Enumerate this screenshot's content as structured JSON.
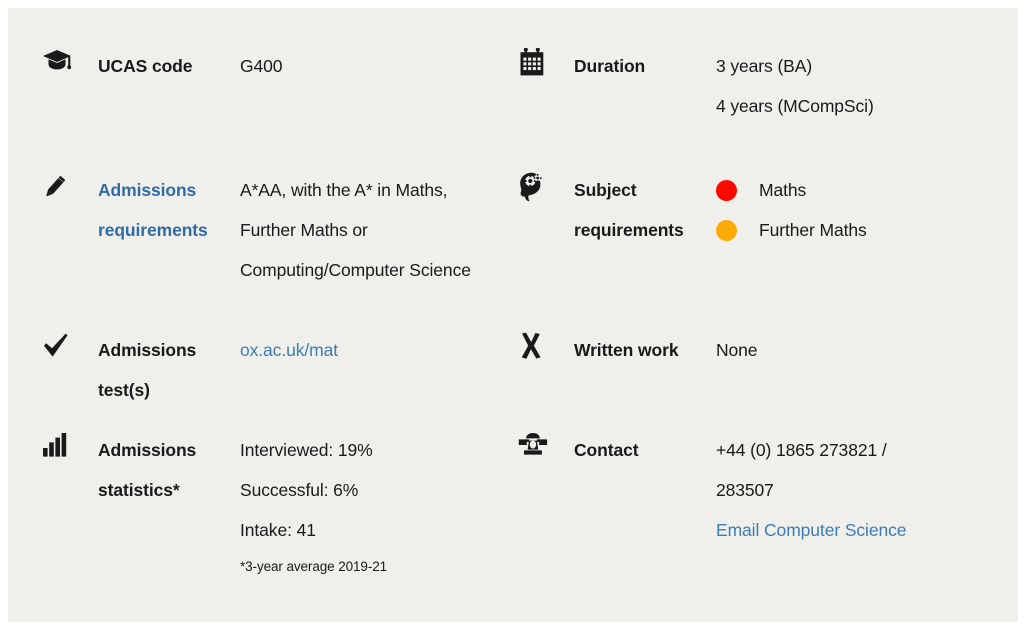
{
  "panel": {
    "background": "#f1efeb",
    "link_color": "#3b7eb5",
    "label_link_color": "#2f6ca3",
    "text_color": "#1a1a1a"
  },
  "facts": {
    "ucas": {
      "icon": "graduation-cap-icon",
      "label": "UCAS code",
      "value": "G400"
    },
    "duration": {
      "icon": "calendar-icon",
      "label": "Duration",
      "value_line1": "3 years (BA)",
      "value_line2": "4 years (MCompSci)"
    },
    "admissions_requirements": {
      "icon": "pencil-icon",
      "label": "Admissions requirements",
      "label_is_link": true,
      "value_line1": "A*AA, with the A* in Maths,",
      "value_line2": "Further Maths or",
      "value_line3": "Computing/Computer Science"
    },
    "subject_requirements": {
      "icon": "head-gears-icon",
      "label": "Subject requirements",
      "items": [
        {
          "color": "#fa0a00",
          "label": "Maths"
        },
        {
          "color": "#fbab09",
          "label": "Further Maths"
        }
      ]
    },
    "admissions_tests": {
      "icon": "check-icon",
      "label": "Admissions test(s)",
      "value": "ox.ac.uk/mat",
      "value_is_link": true
    },
    "written_work": {
      "icon": "cross-icon",
      "label": "Written work",
      "value": "None"
    },
    "admissions_statistics": {
      "icon": "bar-chart-icon",
      "label": "Admissions statistics*",
      "value_line1": "Interviewed: 19%",
      "value_line2": "Successful: 6%",
      "value_line3": "Intake: 41",
      "footnote": "*3-year average 2019-21"
    },
    "contact": {
      "icon": "telephone-icon",
      "label": "Contact",
      "value_line1": "+44 (0) 1865 273821 /",
      "value_line2": "283507",
      "email_link": "Email Computer Science"
    }
  }
}
